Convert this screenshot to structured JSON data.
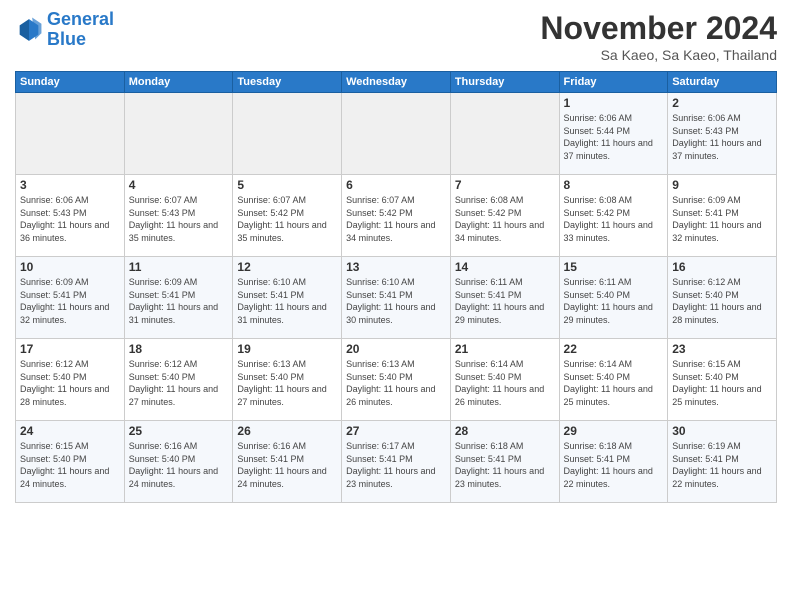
{
  "logo": {
    "line1": "General",
    "line2": "Blue"
  },
  "title": "November 2024",
  "subtitle": "Sa Kaeo, Sa Kaeo, Thailand",
  "days_of_week": [
    "Sunday",
    "Monday",
    "Tuesday",
    "Wednesday",
    "Thursday",
    "Friday",
    "Saturday"
  ],
  "weeks": [
    [
      {
        "num": "",
        "info": ""
      },
      {
        "num": "",
        "info": ""
      },
      {
        "num": "",
        "info": ""
      },
      {
        "num": "",
        "info": ""
      },
      {
        "num": "",
        "info": ""
      },
      {
        "num": "1",
        "info": "Sunrise: 6:06 AM\nSunset: 5:44 PM\nDaylight: 11 hours and 37 minutes."
      },
      {
        "num": "2",
        "info": "Sunrise: 6:06 AM\nSunset: 5:43 PM\nDaylight: 11 hours and 37 minutes."
      }
    ],
    [
      {
        "num": "3",
        "info": "Sunrise: 6:06 AM\nSunset: 5:43 PM\nDaylight: 11 hours and 36 minutes."
      },
      {
        "num": "4",
        "info": "Sunrise: 6:07 AM\nSunset: 5:43 PM\nDaylight: 11 hours and 35 minutes."
      },
      {
        "num": "5",
        "info": "Sunrise: 6:07 AM\nSunset: 5:42 PM\nDaylight: 11 hours and 35 minutes."
      },
      {
        "num": "6",
        "info": "Sunrise: 6:07 AM\nSunset: 5:42 PM\nDaylight: 11 hours and 34 minutes."
      },
      {
        "num": "7",
        "info": "Sunrise: 6:08 AM\nSunset: 5:42 PM\nDaylight: 11 hours and 34 minutes."
      },
      {
        "num": "8",
        "info": "Sunrise: 6:08 AM\nSunset: 5:42 PM\nDaylight: 11 hours and 33 minutes."
      },
      {
        "num": "9",
        "info": "Sunrise: 6:09 AM\nSunset: 5:41 PM\nDaylight: 11 hours and 32 minutes."
      }
    ],
    [
      {
        "num": "10",
        "info": "Sunrise: 6:09 AM\nSunset: 5:41 PM\nDaylight: 11 hours and 32 minutes."
      },
      {
        "num": "11",
        "info": "Sunrise: 6:09 AM\nSunset: 5:41 PM\nDaylight: 11 hours and 31 minutes."
      },
      {
        "num": "12",
        "info": "Sunrise: 6:10 AM\nSunset: 5:41 PM\nDaylight: 11 hours and 31 minutes."
      },
      {
        "num": "13",
        "info": "Sunrise: 6:10 AM\nSunset: 5:41 PM\nDaylight: 11 hours and 30 minutes."
      },
      {
        "num": "14",
        "info": "Sunrise: 6:11 AM\nSunset: 5:41 PM\nDaylight: 11 hours and 29 minutes."
      },
      {
        "num": "15",
        "info": "Sunrise: 6:11 AM\nSunset: 5:40 PM\nDaylight: 11 hours and 29 minutes."
      },
      {
        "num": "16",
        "info": "Sunrise: 6:12 AM\nSunset: 5:40 PM\nDaylight: 11 hours and 28 minutes."
      }
    ],
    [
      {
        "num": "17",
        "info": "Sunrise: 6:12 AM\nSunset: 5:40 PM\nDaylight: 11 hours and 28 minutes."
      },
      {
        "num": "18",
        "info": "Sunrise: 6:12 AM\nSunset: 5:40 PM\nDaylight: 11 hours and 27 minutes."
      },
      {
        "num": "19",
        "info": "Sunrise: 6:13 AM\nSunset: 5:40 PM\nDaylight: 11 hours and 27 minutes."
      },
      {
        "num": "20",
        "info": "Sunrise: 6:13 AM\nSunset: 5:40 PM\nDaylight: 11 hours and 26 minutes."
      },
      {
        "num": "21",
        "info": "Sunrise: 6:14 AM\nSunset: 5:40 PM\nDaylight: 11 hours and 26 minutes."
      },
      {
        "num": "22",
        "info": "Sunrise: 6:14 AM\nSunset: 5:40 PM\nDaylight: 11 hours and 25 minutes."
      },
      {
        "num": "23",
        "info": "Sunrise: 6:15 AM\nSunset: 5:40 PM\nDaylight: 11 hours and 25 minutes."
      }
    ],
    [
      {
        "num": "24",
        "info": "Sunrise: 6:15 AM\nSunset: 5:40 PM\nDaylight: 11 hours and 24 minutes."
      },
      {
        "num": "25",
        "info": "Sunrise: 6:16 AM\nSunset: 5:40 PM\nDaylight: 11 hours and 24 minutes."
      },
      {
        "num": "26",
        "info": "Sunrise: 6:16 AM\nSunset: 5:41 PM\nDaylight: 11 hours and 24 minutes."
      },
      {
        "num": "27",
        "info": "Sunrise: 6:17 AM\nSunset: 5:41 PM\nDaylight: 11 hours and 23 minutes."
      },
      {
        "num": "28",
        "info": "Sunrise: 6:18 AM\nSunset: 5:41 PM\nDaylight: 11 hours and 23 minutes."
      },
      {
        "num": "29",
        "info": "Sunrise: 6:18 AM\nSunset: 5:41 PM\nDaylight: 11 hours and 22 minutes."
      },
      {
        "num": "30",
        "info": "Sunrise: 6:19 AM\nSunset: 5:41 PM\nDaylight: 11 hours and 22 minutes."
      }
    ]
  ]
}
